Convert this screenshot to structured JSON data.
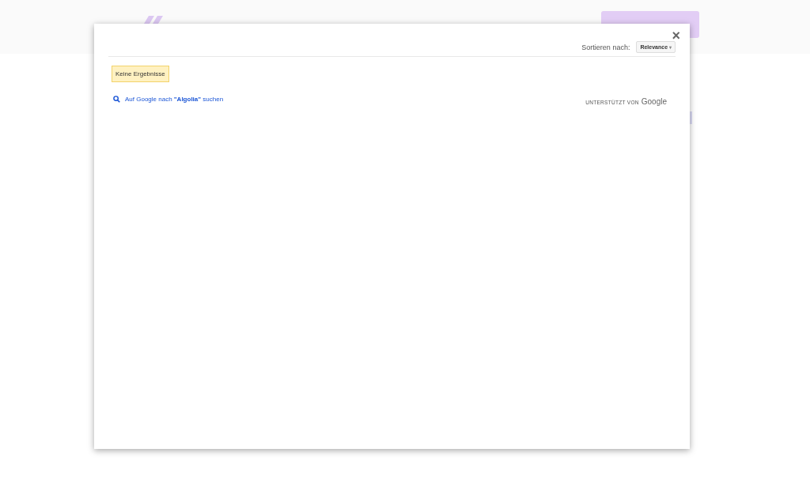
{
  "dialog": {
    "close": "×",
    "sort_label": "Sortieren nach:",
    "sort_value": "Relevance",
    "sort_caret": "▾",
    "no_results": "Keine Ergebnisse",
    "google_link": "Auf Google nach **\"Algolia\"** suchen",
    "powered_by": "UNTERSTÜTZT VON",
    "powered_brand": "Google"
  }
}
